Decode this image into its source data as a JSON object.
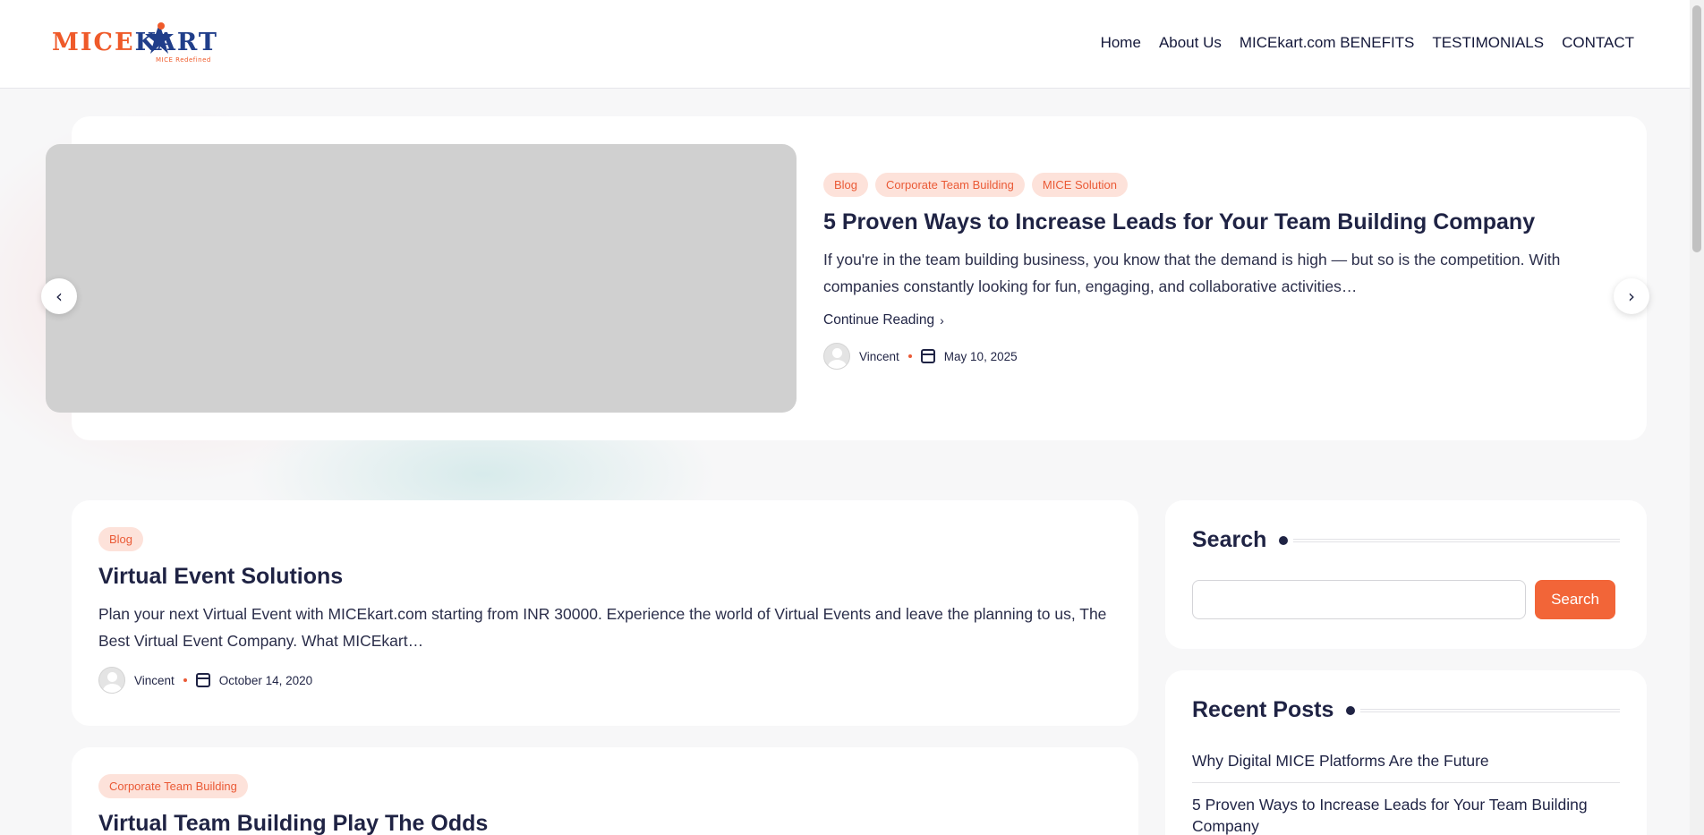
{
  "header": {
    "logo_text_a": "MICE",
    "logo_text_b": "KART",
    "logo_tagline": "MICE Redefined",
    "nav": [
      "Home",
      "About Us",
      "MICEkart.com BENEFITS",
      "TESTIMONIALS",
      "CONTACT"
    ]
  },
  "hero": {
    "tags": [
      "Blog",
      "Corporate Team Building",
      "MICE Solution"
    ],
    "title": "5 Proven Ways to Increase Leads for Your Team Building Company",
    "excerpt": "If you're in the team building business, you know that the demand is high — but so is the competition. With companies constantly looking for fun, engaging, and collaborative activities…",
    "continue_label": "Continue Reading",
    "author": "Vincent",
    "date": "May 10, 2025",
    "prev_icon": "chevron-left-icon",
    "next_icon": "chevron-right-icon"
  },
  "posts": [
    {
      "tag": "Blog",
      "title": "Virtual Event Solutions",
      "excerpt": "Plan your next Virtual Event with MICEkart.com starting from INR 30000. Experience the world of Virtual Events and leave the planning to us, The Best Virtual Event Company. What MICEkart…",
      "author": "Vincent",
      "date": "October 14, 2020"
    },
    {
      "tag": "Corporate Team Building",
      "title": "Virtual Team Building Play The Odds"
    }
  ],
  "sidebar": {
    "search_title": "Search",
    "search_button": "Search",
    "search_placeholder": "",
    "recent_title": "Recent Posts",
    "recent": [
      "Why Digital MICE Platforms Are the Future",
      "5 Proven Ways to Increase Leads for Your Team Building Company"
    ]
  },
  "colors": {
    "accent": "#f26538",
    "tag_bg": "#fde2da",
    "text": "#1f2344"
  }
}
